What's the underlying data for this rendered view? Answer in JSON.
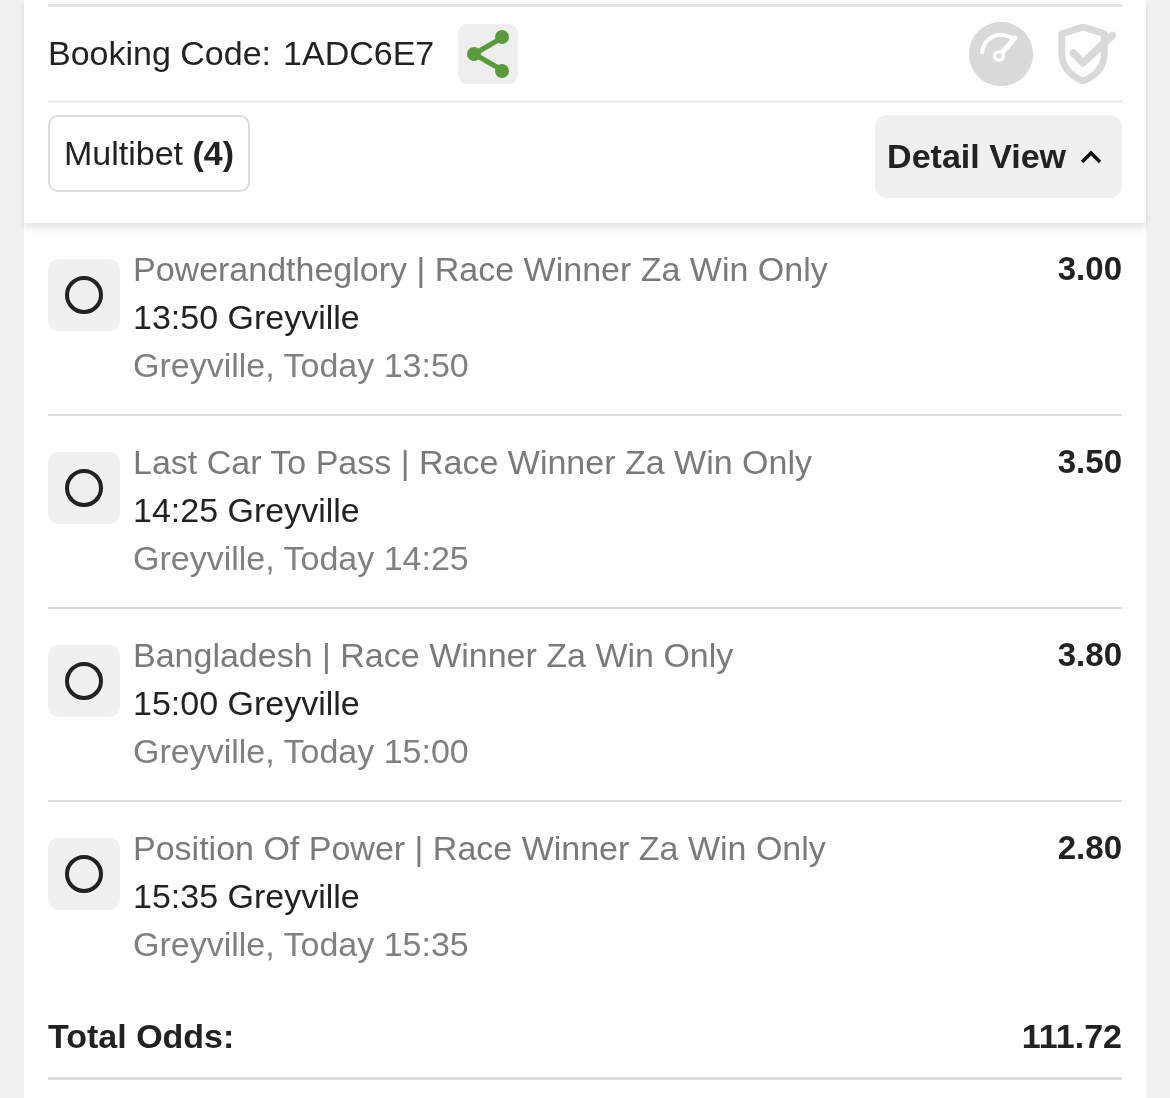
{
  "booking": {
    "label": "Booking Code:",
    "code": "1ADC6E7"
  },
  "bet_type": {
    "label": "Multibet **(4)**"
  },
  "view_toggle": {
    "label": "Detail View",
    "expanded": true
  },
  "selections": [
    {
      "selected": false,
      "title": "Powerandtheglory | Race Winner Za Win Only",
      "event": "13:50 Greyville",
      "schedule": "Greyville, Today 13:50",
      "odds": "3.00"
    },
    {
      "selected": false,
      "title": "Last Car To Pass | Race Winner Za Win Only",
      "event": "14:25 Greyville",
      "schedule": "Greyville, Today 14:25",
      "odds": "3.50"
    },
    {
      "selected": false,
      "title": "Bangladesh | Race Winner Za Win Only",
      "event": "15:00 Greyville",
      "schedule": "Greyville, Today 15:00",
      "odds": "3.80"
    },
    {
      "selected": false,
      "title": "Position Of Power | Race Winner Za Win Only",
      "event": "15:35 Greyville",
      "schedule": "Greyville, Today 15:35",
      "odds": "2.80"
    }
  ],
  "total": {
    "label": "Total Odds:",
    "value": "111.72"
  }
}
